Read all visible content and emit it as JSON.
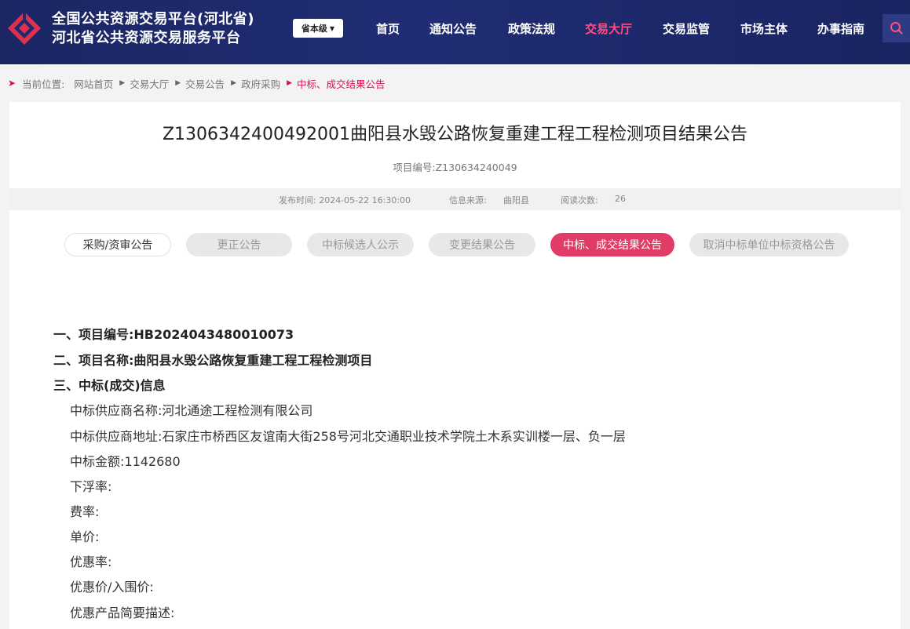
{
  "header": {
    "logo_icon": "hebei-ggzy-logo-icon",
    "title_line1": "全国公共资源交易平台(河北省)",
    "title_line2": "河北省公共资源交易服务平台",
    "level_select": "省本级",
    "nav": [
      {
        "label": "首页",
        "active": false
      },
      {
        "label": "通知公告",
        "active": false
      },
      {
        "label": "政策法规",
        "active": false
      },
      {
        "label": "交易大厅",
        "active": true
      },
      {
        "label": "交易监管",
        "active": false
      },
      {
        "label": "市场主体",
        "active": false
      },
      {
        "label": "办事指南",
        "active": false
      }
    ],
    "search_icon": "search-icon",
    "accent_color": "#ff4f7e",
    "bg_color": "#1e2a6e"
  },
  "breadcrumb": {
    "prefix": "当前位置:",
    "items": [
      "网站首页",
      "交易大厅",
      "交易公告",
      "政府采购"
    ],
    "current": "中标、成交结果公告"
  },
  "article": {
    "title": "Z1306342400492001曲阳县水毁公路恢复重建工程工程检测项目结果公告",
    "project_no_label": "项目编号:Z130634240049",
    "meta": {
      "publish_time": "发布时间: 2024-05-22 16:30:00",
      "source_label": "信息来源:",
      "source_value": "曲阳县",
      "reads_label": "阅读次数:",
      "reads_value": "26"
    },
    "tabs": [
      {
        "label": "采购/资审公告",
        "state": "plain"
      },
      {
        "label": "更正公告",
        "state": "disabled"
      },
      {
        "label": "中标候选人公示",
        "state": "disabled"
      },
      {
        "label": "变更结果公告",
        "state": "disabled"
      },
      {
        "label": "中标、成交结果公告",
        "state": "active"
      },
      {
        "label": "取消中标单位中标资格公告",
        "state": "disabled"
      }
    ],
    "lines": [
      "一、项目编号:HB2024043480010073",
      "二、项目名称:曲阳县水毁公路恢复重建工程工程检测项目",
      "三、中标(成交)信息",
      "中标供应商名称:河北通途工程检测有限公司",
      "中标供应商地址:石家庄市桥西区友谊南大街258号河北交通职业技术学院土木系实训楼一层、负一层",
      "中标金额:1142680",
      "下浮率:",
      "费率:",
      "单价:",
      "优惠率:",
      "优惠价/入围价:",
      "优惠产品简要描述:"
    ]
  }
}
